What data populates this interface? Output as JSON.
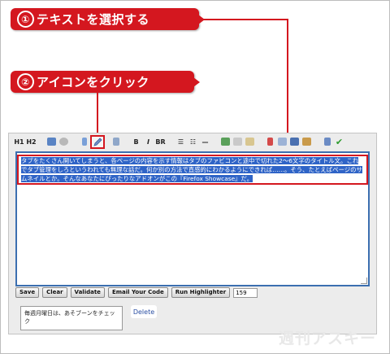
{
  "callouts": [
    {
      "number": "①",
      "text": "テキストを選択する"
    },
    {
      "number": "②",
      "text": "アイコンをクリック"
    }
  ],
  "toolbar": {
    "items": [
      "H1",
      "H2",
      "image-icon",
      "circle-icon",
      "link-icon",
      "pencil-icon",
      "pen-icon",
      "B",
      "I",
      "BR",
      "bullet-list-icon",
      "numbered-list-icon",
      "horizontal-rule-icon",
      "picture-icon",
      "link-icon",
      "mail-icon",
      "highlighter-icon",
      "document-icon",
      "save-icon",
      "package-icon",
      "tools-icon",
      "check-icon"
    ],
    "labels": {
      "h1": "H1",
      "h2": "H2",
      "bold": "B",
      "italic": "I",
      "br": "BR"
    }
  },
  "editor": {
    "selected_text": "タブをたくさん開いてしまうと、各ページの内容を示す情報はタブのファビコンと途中で切れた2〜6文字のタイトル文。これでタブ管理をしろというわれても無理な話だ。何か別の方法で直感的にわかるようにできれば……。そう、たとえばページのサムネイルとか。そんなあなたにぴったりなアドオンがこの『Firefox Showcase』だ。"
  },
  "buttons": {
    "save": "Save",
    "clear": "Clear",
    "validate": "Validate",
    "email": "Email Your Code",
    "highlighter": "Run Highlighter",
    "count": "159"
  },
  "comment": {
    "text": "毎週月曜日は、あそブーンをチェック"
  },
  "delete_label": "Delete",
  "watermark": "週刊アスキー",
  "colors": {
    "accent": "#d4171f",
    "selection": "#2f64c7",
    "editor_border": "#3c6fb0"
  }
}
